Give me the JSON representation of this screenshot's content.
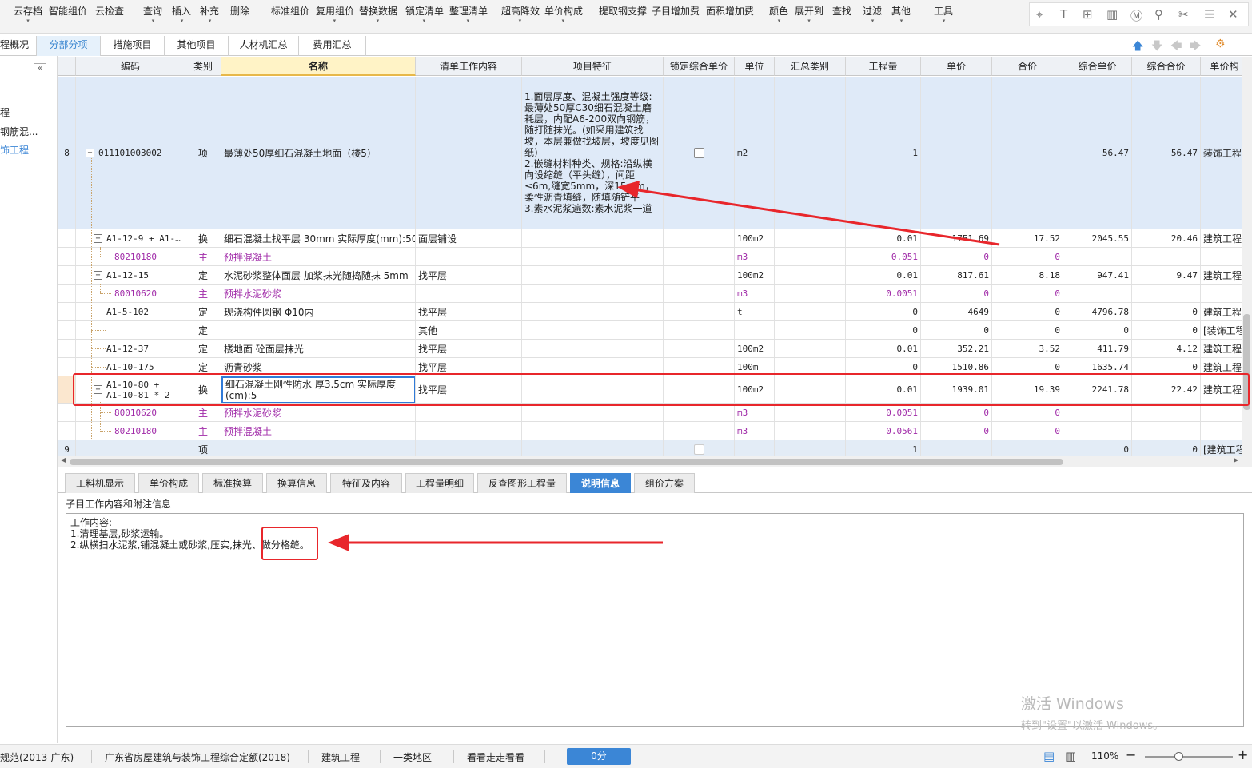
{
  "toolbar": {
    "buttons": [
      "云存档",
      "智能组价",
      "云检查",
      "查询",
      "插入",
      "补充",
      "删除",
      "标准组价",
      "复用组价",
      "替换数据",
      "锁定清单",
      "整理清单",
      "超高降效",
      "单价构成",
      "提取钢支撑",
      "子目增加费",
      "面积增加费",
      "颜色",
      "展开到",
      "查找",
      "过滤",
      "其他",
      "工具"
    ]
  },
  "top_tabs": [
    "程概况",
    "分部分项",
    "措施项目",
    "其他项目",
    "人材机汇总",
    "费用汇总"
  ],
  "left_tree": [
    "程",
    "钢筋混...",
    "饰工程"
  ],
  "grid": {
    "headers": [
      "编码",
      "类别",
      "名称",
      "清单工作内容",
      "项目特征",
      "锁定综合单价",
      "单位",
      "汇总类别",
      "工程量",
      "单价",
      "合价",
      "综合单价",
      "综合合价",
      "单价构"
    ],
    "rows": [
      {
        "seq": "8",
        "code": "011101003002",
        "type": "项",
        "name": "最薄处50厚细石混凝土地面（楼5）",
        "content": "",
        "feature": "1.面层厚度、混凝土强度等级:最薄处50厚C30细石混凝土磨耗层，内配A6-200双向钢筋，随打随抹光。(如采用建筑找坡，本层兼做找坡层，坡度见图纸)\n2.嵌缝材料种类、规格:沿纵横向设缩缝（平头缝），间距≤6m,缝宽5mm，深15mm，柔性沥青填缝，随填随铲平\n3.素水泥浆遍数:素水泥浆一道",
        "lock": true,
        "unit": "m2",
        "sumcat": "",
        "qty": "1",
        "price": "",
        "total": "",
        "cprice": "56.47",
        "ctotal": "56.47",
        "pricecomp": "装饰工程"
      },
      {
        "seq": "",
        "code": "A1-12-9 + A1-…",
        "type": "换",
        "name": "细石混凝土找平层 30mm  实际厚度(mm):50",
        "content": "面层铺设",
        "feature": "",
        "unit": "100m2",
        "sumcat": "",
        "qty": "0.01",
        "price": "1751.69",
        "total": "17.52",
        "cprice": "2045.55",
        "ctotal": "20.46",
        "pricecomp": "建筑工程"
      },
      {
        "seq": "",
        "code": "80210180",
        "type": "主",
        "name": "预拌混凝土",
        "content": "",
        "feature": "",
        "unit": "m3",
        "sumcat": "",
        "qty": "0.051",
        "price": "0",
        "total": "0",
        "cprice": "",
        "ctotal": "",
        "pricecomp": ""
      },
      {
        "seq": "",
        "code": "A1-12-15",
        "type": "定",
        "name": "水泥砂浆整体面层 加浆抹光随捣随抹 5mm",
        "content": "找平层",
        "feature": "",
        "unit": "100m2",
        "sumcat": "",
        "qty": "0.01",
        "price": "817.61",
        "total": "8.18",
        "cprice": "947.41",
        "ctotal": "9.47",
        "pricecomp": "建筑工程"
      },
      {
        "seq": "",
        "code": "80010620",
        "type": "主",
        "name": "预拌水泥砂浆",
        "content": "",
        "feature": "",
        "unit": "m3",
        "sumcat": "",
        "qty": "0.0051",
        "price": "0",
        "total": "0",
        "cprice": "",
        "ctotal": "",
        "pricecomp": ""
      },
      {
        "seq": "",
        "code": "A1-5-102",
        "type": "定",
        "name": "现浇构件圆钢 Φ10内",
        "content": "找平层",
        "feature": "",
        "unit": "t",
        "sumcat": "",
        "qty": "0",
        "price": "4649",
        "total": "0",
        "cprice": "4796.78",
        "ctotal": "0",
        "pricecomp": "建筑工程"
      },
      {
        "seq": "",
        "code": "",
        "type": "定",
        "name": "",
        "content": "其他",
        "feature": "",
        "unit": "",
        "sumcat": "",
        "qty": "0",
        "price": "0",
        "total": "0",
        "cprice": "0",
        "ctotal": "0",
        "pricecomp": "[装饰工程"
      },
      {
        "seq": "",
        "code": "A1-12-37",
        "type": "定",
        "name": "楼地面 砼面层抹光",
        "content": "找平层",
        "feature": "",
        "unit": "100m2",
        "sumcat": "",
        "qty": "0.01",
        "price": "352.21",
        "total": "3.52",
        "cprice": "411.79",
        "ctotal": "4.12",
        "pricecomp": "建筑工程"
      },
      {
        "seq": "",
        "code": "A1-10-175",
        "type": "定",
        "name": "沥青砂浆",
        "content": "找平层",
        "feature": "",
        "unit": "100m",
        "sumcat": "",
        "qty": "0",
        "price": "1510.86",
        "total": "0",
        "cprice": "1635.74",
        "ctotal": "0",
        "pricecomp": "建筑工程"
      },
      {
        "seq": "",
        "code": "A1-10-80 + A1-10-81 * 2",
        "type": "换",
        "name": "细石混凝土刚性防水 厚3.5cm  实际厚度(cm):5",
        "content": "找平层",
        "feature": "",
        "unit": "100m2",
        "sumcat": "",
        "qty": "0.01",
        "price": "1939.01",
        "total": "19.39",
        "cprice": "2241.78",
        "ctotal": "22.42",
        "pricecomp": "建筑工程"
      },
      {
        "seq": "",
        "code": "80010620",
        "type": "主",
        "name": "预拌水泥砂浆",
        "content": "",
        "feature": "",
        "unit": "m3",
        "sumcat": "",
        "qty": "0.0051",
        "price": "0",
        "total": "0",
        "cprice": "",
        "ctotal": "",
        "pricecomp": ""
      },
      {
        "seq": "",
        "code": "80210180",
        "type": "主",
        "name": "预拌混凝土",
        "content": "",
        "feature": "",
        "unit": "m3",
        "sumcat": "",
        "qty": "0.0561",
        "price": "0",
        "total": "0",
        "cprice": "",
        "ctotal": "",
        "pricecomp": ""
      },
      {
        "seq": "9",
        "code": "",
        "type": "项",
        "name": "",
        "content": "",
        "feature": "",
        "lock": false,
        "unit": "",
        "sumcat": "",
        "qty": "1",
        "price": "",
        "total": "",
        "cprice": "0",
        "ctotal": "0",
        "pricecomp": "[建筑工程"
      }
    ]
  },
  "bottom_tabs": [
    "工料机显示",
    "单价构成",
    "标准换算",
    "换算信息",
    "特征及内容",
    "工程量明细",
    "反查图形工程量",
    "说明信息",
    "组价方案"
  ],
  "info": {
    "title": "子目工作内容和附注信息",
    "line1": "工作内容:",
    "line2": "1.清理基层,砂浆运输。",
    "line3a": "2.纵横扫水泥浆,铺混凝土或砂浆,压实,抹光、",
    "line3b": "做分格缝。"
  },
  "watermark": {
    "line1": "激活 Windows",
    "line2": "转到\"设置\"以激活 Windows。"
  },
  "status": {
    "s1": "规范(2013-广东)",
    "s2": "广东省房屋建筑与装饰工程综合定额(2018)",
    "s3": "建筑工程",
    "s4": "一类地区",
    "s5": "看看走走看看",
    "score": "0分",
    "zoom": "110%"
  },
  "colors": {
    "accent": "#3b86d6",
    "annotation": "#e8262b",
    "material_text": "#a02aa8"
  }
}
